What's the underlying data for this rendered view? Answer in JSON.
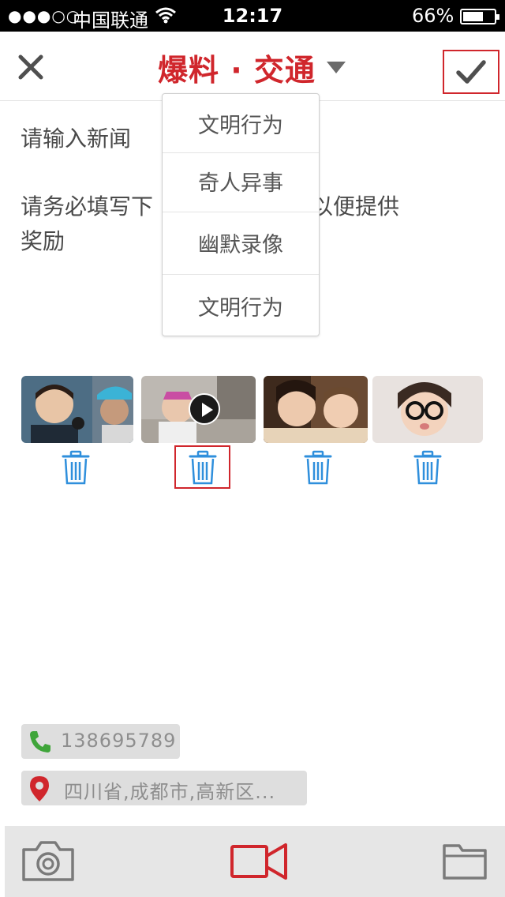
{
  "status_bar": {
    "signal": "●●●○○",
    "carrier": "中国联通",
    "time": "12:17",
    "battery_percent": "66%",
    "battery_level": 0.66
  },
  "nav": {
    "title": "爆料 · 交通",
    "close_icon": "close-icon",
    "confirm_icon": "checkmark-icon",
    "accent_color": "#d0262c"
  },
  "editor": {
    "news_placeholder": "请输入新闻",
    "instruction_line1": "请务必填写下",
    "instruction_line1_tail": "以便提供",
    "instruction_line2": "奖励"
  },
  "category_menu": {
    "items": [
      "文明行为",
      "奇人异事",
      "幽默录像",
      "文明行为"
    ]
  },
  "media": {
    "items": [
      {
        "type": "photo",
        "delete_icon": "trash-icon"
      },
      {
        "type": "video",
        "delete_icon": "trash-icon"
      },
      {
        "type": "photo",
        "delete_icon": "trash-icon"
      },
      {
        "type": "photo",
        "delete_icon": "trash-icon"
      }
    ]
  },
  "contact": {
    "phone": "138695789",
    "location": "四川省,成都市,高新区..."
  },
  "toolbar": {
    "icons": [
      "camera-icon",
      "video-camera-icon",
      "folder-icon"
    ]
  }
}
